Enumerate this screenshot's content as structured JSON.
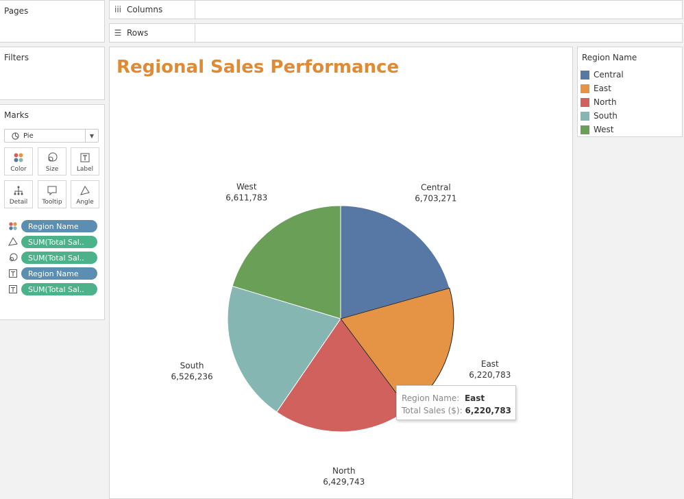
{
  "panels": {
    "pages": "Pages",
    "filters": "Filters",
    "marks": "Marks"
  },
  "shelves": {
    "columns": "Columns",
    "rows": "Rows"
  },
  "marks": {
    "type": "Pie",
    "buttons": [
      "Color",
      "Size",
      "Label",
      "Detail",
      "Tooltip",
      "Angle"
    ],
    "pills": [
      {
        "icon": "color-icon",
        "label": "Region Name",
        "style": "blue"
      },
      {
        "icon": "angle-icon",
        "label": "SUM(Total Sal..",
        "style": "green"
      },
      {
        "icon": "size-icon",
        "label": "SUM(Total Sal..",
        "style": "green"
      },
      {
        "icon": "label-icon",
        "label": "Region Name",
        "style": "blue"
      },
      {
        "icon": "label-icon",
        "label": "SUM(Total Sal..",
        "style": "green"
      }
    ]
  },
  "legend": {
    "title": "Region Name",
    "items": [
      {
        "label": "Central",
        "color": "#5778a4"
      },
      {
        "label": "East",
        "color": "#e49444"
      },
      {
        "label": "North",
        "color": "#d1615d"
      },
      {
        "label": "South",
        "color": "#85b6b2"
      },
      {
        "label": "West",
        "color": "#6a9f58"
      }
    ]
  },
  "tooltip": {
    "name_key": "Region Name:",
    "name_val": "East",
    "sales_key": "Total Sales ($):",
    "sales_val": "6,220,783"
  },
  "chart_data": {
    "type": "pie",
    "title": "Regional Sales Performance",
    "categories": [
      "Central",
      "East",
      "North",
      "South",
      "West"
    ],
    "values": [
      6703271,
      6220783,
      6429743,
      6526236,
      6611783
    ],
    "value_labels": [
      "6,703,271",
      "6,220,783",
      "6,429,743",
      "6,526,236",
      "6,611,783"
    ],
    "colors": [
      "#5778a4",
      "#e49444",
      "#d1615d",
      "#85b6b2",
      "#6a9f58"
    ],
    "highlighted": "East"
  }
}
